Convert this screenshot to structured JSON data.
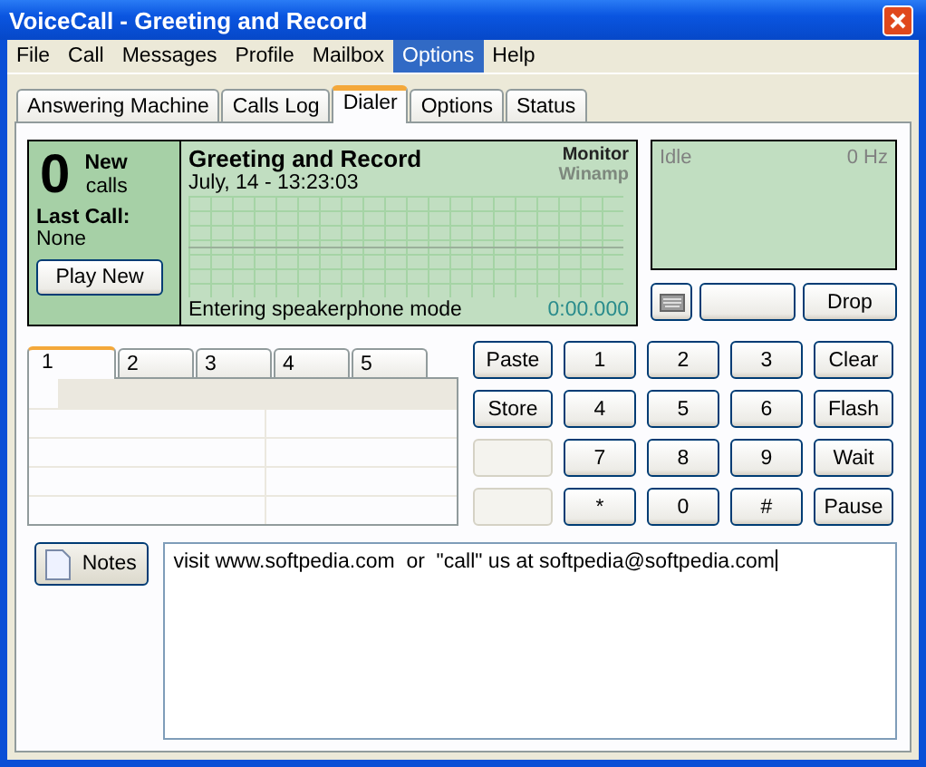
{
  "window": {
    "title": "VoiceCall - Greeting and Record"
  },
  "menu": [
    {
      "label": "File",
      "selected": false
    },
    {
      "label": "Call",
      "selected": false
    },
    {
      "label": "Messages",
      "selected": false
    },
    {
      "label": "Profile",
      "selected": false
    },
    {
      "label": "Mailbox",
      "selected": false
    },
    {
      "label": "Options",
      "selected": true
    },
    {
      "label": "Help",
      "selected": false
    }
  ],
  "tabs": [
    {
      "label": "Answering Machine",
      "selected": false
    },
    {
      "label": "Calls Log",
      "selected": false
    },
    {
      "label": "Dialer",
      "selected": true
    },
    {
      "label": "Options",
      "selected": false
    },
    {
      "label": "Status",
      "selected": false
    }
  ],
  "calls": {
    "count": "0",
    "new_label": "New",
    "calls_label": "calls",
    "last_call_label": "Last Call:",
    "last_call": "None",
    "play_button": "Play New"
  },
  "display": {
    "title": "Greeting and Record",
    "date": "July, 14 - 13:23:03",
    "sources": [
      {
        "label": "Monitor",
        "active": true
      },
      {
        "label": "Winamp",
        "active": false
      }
    ],
    "status": "Entering speakerphone mode",
    "timer": "0:00.000"
  },
  "line_display": {
    "state": "Idle",
    "frequency": "0 Hz"
  },
  "line_buttons": [
    {
      "kind": "icon"
    },
    {
      "kind": "blank"
    },
    {
      "kind": "text",
      "label": "Drop"
    }
  ],
  "memory_tabs": [
    {
      "label": "1",
      "selected": true
    },
    {
      "label": "2",
      "selected": false
    },
    {
      "label": "3",
      "selected": false
    },
    {
      "label": "4",
      "selected": false
    },
    {
      "label": "5",
      "selected": false
    }
  ],
  "keypad": [
    {
      "label": "Paste",
      "disabled": false
    },
    {
      "label": "1",
      "disabled": false
    },
    {
      "label": "2",
      "disabled": false
    },
    {
      "label": "3",
      "disabled": false
    },
    {
      "label": "Clear",
      "disabled": false
    },
    {
      "label": "Store",
      "disabled": false
    },
    {
      "label": "4",
      "disabled": false
    },
    {
      "label": "5",
      "disabled": false
    },
    {
      "label": "6",
      "disabled": false
    },
    {
      "label": "Flash",
      "disabled": false
    },
    {
      "disabled": true
    },
    {
      "label": "7",
      "disabled": false
    },
    {
      "label": "8",
      "disabled": false
    },
    {
      "label": "9",
      "disabled": false
    },
    {
      "label": "Wait",
      "disabled": false
    },
    {
      "disabled": true
    },
    {
      "label": "*",
      "disabled": false
    },
    {
      "label": "0",
      "disabled": false
    },
    {
      "label": "#",
      "disabled": false
    },
    {
      "label": "Pause",
      "disabled": false
    }
  ],
  "notes": {
    "button": "Notes",
    "text": "visit www.softpedia.com  or  \"call\" us at softpedia@softpedia.com"
  }
}
